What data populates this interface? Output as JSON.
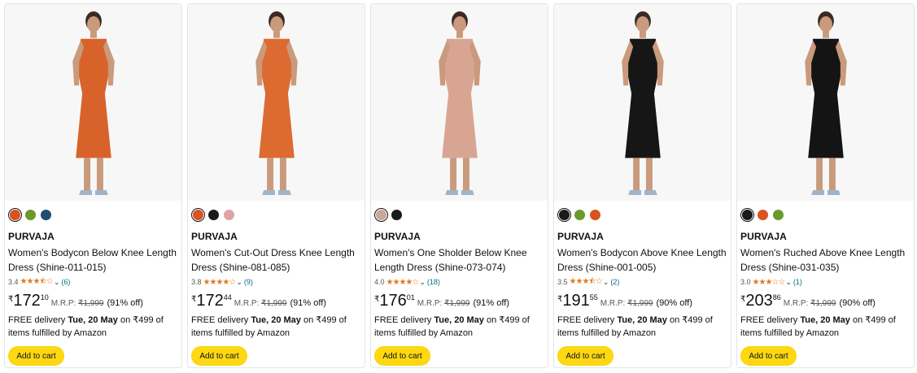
{
  "products": [
    {
      "brand": "PURVAJA",
      "title": "Women's Bodycon Below Knee Length Dress (Shine-011-015)",
      "rating": "3.4",
      "stars": "★★★⯪☆",
      "review_count": "(6)",
      "currency": "₹",
      "price_whole": "172",
      "price_fraction": "10",
      "mrp_label": "M.R.P:",
      "mrp_value": "₹1,999",
      "discount": "(91% off)",
      "delivery_prefix": "FREE delivery ",
      "delivery_date": "Tue, 20 May",
      "delivery_suffix": " on ₹499 of items fulfilled by Amazon",
      "cart_label": "Add to cart",
      "swatches": [
        "#d9531e",
        "#6a9a2b",
        "#1f4e6e"
      ],
      "dress_color": "#d8632a"
    },
    {
      "brand": "PURVAJA",
      "title": "Women's Cut-Out Dress Knee Length Dress (Shine-081-085)",
      "rating": "3.8",
      "stars": "★★★★☆",
      "review_count": "(9)",
      "currency": "₹",
      "price_whole": "172",
      "price_fraction": "44",
      "mrp_label": "M.R.P:",
      "mrp_value": "₹1,999",
      "discount": "(91% off)",
      "delivery_prefix": "FREE delivery ",
      "delivery_date": "Tue, 20 May",
      "delivery_suffix": " on ₹499 of items fulfilled by Amazon",
      "cart_label": "Add to cart",
      "swatches": [
        "#d9531e",
        "#1a1a1a",
        "#e0a3a3"
      ],
      "dress_color": "#dd6a30"
    },
    {
      "brand": "PURVAJA",
      "title": "Women's One Sholder Below Knee Length Dress (Shine-073-074)",
      "rating": "4.0",
      "stars": "★★★★☆",
      "review_count": "(18)",
      "currency": "₹",
      "price_whole": "176",
      "price_fraction": "01",
      "mrp_label": "M.R.P:",
      "mrp_value": "₹1,999",
      "discount": "(91% off)",
      "delivery_prefix": "FREE delivery ",
      "delivery_date": "Tue, 20 May",
      "delivery_suffix": " on ₹499 of items fulfilled by Amazon",
      "cart_label": "Add to cart",
      "swatches": [
        "#c9a898",
        "#1a1a1a"
      ],
      "dress_color": "#d9a593"
    },
    {
      "brand": "PURVAJA",
      "title": "Women's Bodycon Above Knee Length Dress (Shine-001-005)",
      "rating": "3.5",
      "stars": "★★★⯪☆",
      "review_count": "(2)",
      "currency": "₹",
      "price_whole": "191",
      "price_fraction": "55",
      "mrp_label": "M.R.P:",
      "mrp_value": "₹1,999",
      "discount": "(90% off)",
      "delivery_prefix": "FREE delivery ",
      "delivery_date": "Tue, 20 May",
      "delivery_suffix": " on ₹499 of items fulfilled by Amazon",
      "cart_label": "Add to cart",
      "swatches": [
        "#1a1a1a",
        "#6a9a2b",
        "#d9531e"
      ],
      "dress_color": "#161616"
    },
    {
      "brand": "PURVAJA",
      "title": "Women's Ruched Above Knee Length Dress (Shine-031-035)",
      "rating": "3.0",
      "stars": "★★★☆☆",
      "review_count": "(1)",
      "currency": "₹",
      "price_whole": "203",
      "price_fraction": "86",
      "mrp_label": "M.R.P:",
      "mrp_value": "₹1,999",
      "discount": "(90% off)",
      "delivery_prefix": "FREE delivery ",
      "delivery_date": "Tue, 20 May",
      "delivery_suffix": " on ₹499 of items fulfilled by Amazon",
      "cart_label": "Add to cart",
      "swatches": [
        "#1a1a1a",
        "#d9531e",
        "#6a9a2b"
      ],
      "dress_color": "#141414"
    }
  ],
  "colors": {
    "accent_button": "#ffd814",
    "star": "#de7921",
    "link": "#007185"
  }
}
